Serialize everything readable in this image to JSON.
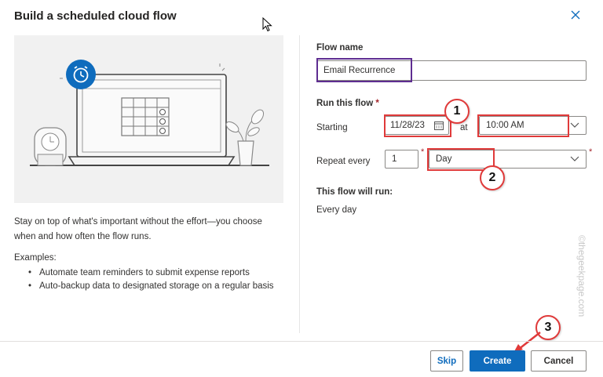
{
  "dialog": {
    "title": "Build a scheduled cloud flow",
    "close_icon": "close-icon"
  },
  "left": {
    "description": "Stay on top of what's important without the effort—you choose when and how often the flow runs.",
    "examples_title": "Examples:",
    "examples": [
      "Automate team reminders to submit expense reports",
      "Auto-backup data to designated storage on a regular basis"
    ]
  },
  "form": {
    "flow_name_label": "Flow name",
    "flow_name_value": "Email Recurrence",
    "run_label": "Run this flow",
    "required_mark": "*",
    "starting_label": "Starting",
    "start_date": "11/28/23",
    "at_label": "at",
    "start_time": "10:00 AM",
    "repeat_label": "Repeat every",
    "repeat_interval": "1",
    "repeat_unit": "Day",
    "will_run_label": "This flow will run:",
    "will_run_value": "Every day"
  },
  "annotations": {
    "badge1": "1",
    "badge2": "2",
    "badge3": "3",
    "highlight_color": "#e03a3a",
    "name_highlight_color": "#5e2d91"
  },
  "watermark": "©thegeekpage.com",
  "footer": {
    "skip_label": "Skip",
    "create_label": "Create",
    "cancel_label": "Cancel"
  },
  "colors": {
    "accent": "#0f6cbd"
  }
}
